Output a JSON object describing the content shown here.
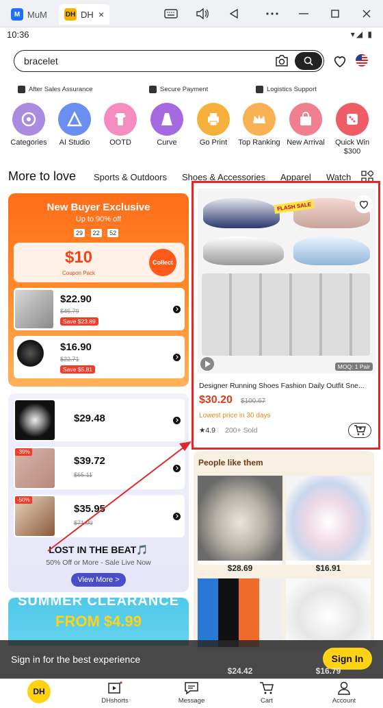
{
  "window": {
    "tabs": [
      {
        "label": "MuM",
        "icon": "mumu-icon"
      },
      {
        "label": "DH",
        "icon": "dhgate-icon"
      }
    ],
    "tab_close": "×",
    "controls": [
      "keyboard-icon",
      "volume-icon",
      "back-icon",
      "more-icon",
      "minimize-icon",
      "maximize-icon",
      "close-icon"
    ]
  },
  "status": {
    "time": "10:36",
    "icons": "▾◢ ▮"
  },
  "search": {
    "query": "bracelet"
  },
  "assurance": [
    "After Sales Assurance",
    "Secure Payment",
    "Logistics Support"
  ],
  "categories": [
    {
      "label": "Categories",
      "color": "#9b7fd6"
    },
    {
      "label": "AI Studio",
      "color": "#5a8cf0"
    },
    {
      "label": "OOTD",
      "color": "#f27ab8"
    },
    {
      "label": "Curve",
      "color": "#9b5ad6"
    },
    {
      "label": "Go Print",
      "color": "#f5a623"
    },
    {
      "label": "Top Ranking",
      "color": "#f7a440"
    },
    {
      "label": "New Arrival",
      "color": "#ef6b7e"
    },
    {
      "label": "Quick Win $300",
      "color": "#ea4b57"
    }
  ],
  "feed": {
    "title": "More to love",
    "tabs": [
      "Sports & Outdoors",
      "Shoes & Accessories",
      "Apparel",
      "Watch"
    ]
  },
  "new_buyer": {
    "title": "New Buyer Exclusive",
    "subtitle": "Up to 90% off",
    "countdown": [
      "29",
      "22",
      "52"
    ],
    "coupon_amount": "$10",
    "coupon_label": "Coupon Pack",
    "collect": "Collect",
    "items": [
      {
        "price": "$22.90",
        "old": "$46.79",
        "save": "Save $23.89"
      },
      {
        "price": "$16.90",
        "old": "$22.71",
        "save": "Save $5.81"
      }
    ]
  },
  "beat": {
    "items": [
      {
        "price": "$29.48",
        "old": "",
        "discount": ""
      },
      {
        "price": "$39.72",
        "old": "$65.11",
        "discount": "-39%"
      },
      {
        "price": "$35.95",
        "old": "$71.90",
        "discount": "-50%"
      }
    ],
    "title": "LOST IN THE BEAT🎵",
    "subtitle": "50% Off or More - Sale Live Now",
    "view_more": "View More  >"
  },
  "summer": {
    "line1": "SUMMER CLEARANCE",
    "line2": "FROM $4.99"
  },
  "product": {
    "badge": "FLASH SALE",
    "moq": "MOQ: 1 Pair",
    "name": "Designer Running Shoes Fashion Daily Outfit Sne...",
    "price": "$30.20",
    "old": "$100.67",
    "lowest": "Lowest price in 30 days",
    "rating": "★4.9",
    "sold": "200+ Sold"
  },
  "people_like": {
    "title": "People like them",
    "items": [
      {
        "price": "$28.69"
      },
      {
        "price": "$16.91"
      },
      {
        "price": "$24.42"
      },
      {
        "price": "$16.79"
      }
    ]
  },
  "signin": {
    "text": "Sign in for the best experience",
    "button": "Sign In"
  },
  "bottom_nav": {
    "logo": "DH",
    "items": [
      "DHshorts",
      "Message",
      "Cart",
      "Account"
    ]
  }
}
